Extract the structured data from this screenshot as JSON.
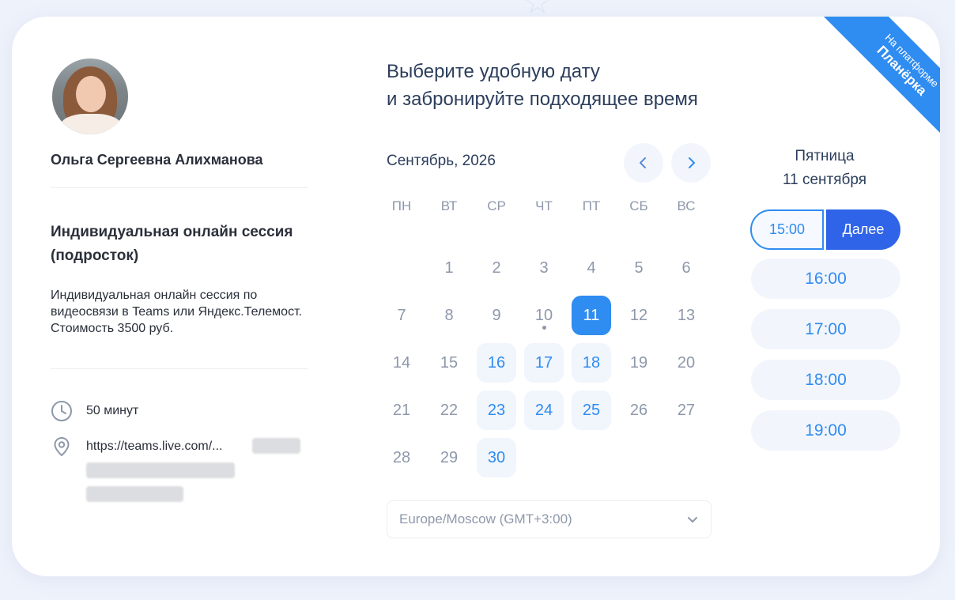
{
  "ribbon": {
    "line1": "На платформе",
    "line2": "Планёрка"
  },
  "profile": {
    "name": "Ольга Сергеевна Алихманова",
    "service_title": "Индивидуальная онлайн сессия (подросток)",
    "service_desc": "Индивидуальная онлайн сессия по видеосвязи в Teams или Яндекс.Телемост. Стоимость 3500 руб.",
    "duration": "50 минут",
    "location": "https://teams.live.com/..."
  },
  "heading": {
    "line1": "Выберите удобную дату",
    "line2": "и забронируйте подходящее время"
  },
  "calendar": {
    "month_label": "Сентябрь, 2026",
    "weekdays": [
      "ПН",
      "ВТ",
      "СР",
      "ЧТ",
      "ПТ",
      "СБ",
      "ВС"
    ],
    "first_weekday_index": 1,
    "days_in_month": 30,
    "available_days": [
      16,
      17,
      18,
      23,
      24,
      25,
      30
    ],
    "selected_day": 11,
    "today_day": 10
  },
  "timezone": {
    "value": "Europe/Moscow (GMT+3:00)"
  },
  "day_panel": {
    "weekday": "Пятница",
    "date": "11 сентября"
  },
  "times": {
    "selected": "15:00",
    "next_label": "Далее",
    "others": [
      "16:00",
      "17:00",
      "18:00",
      "19:00"
    ]
  },
  "colors": {
    "accent": "#2f8cf0",
    "primary_button": "#2f64e8",
    "available_bg": "#f1f5fc"
  }
}
